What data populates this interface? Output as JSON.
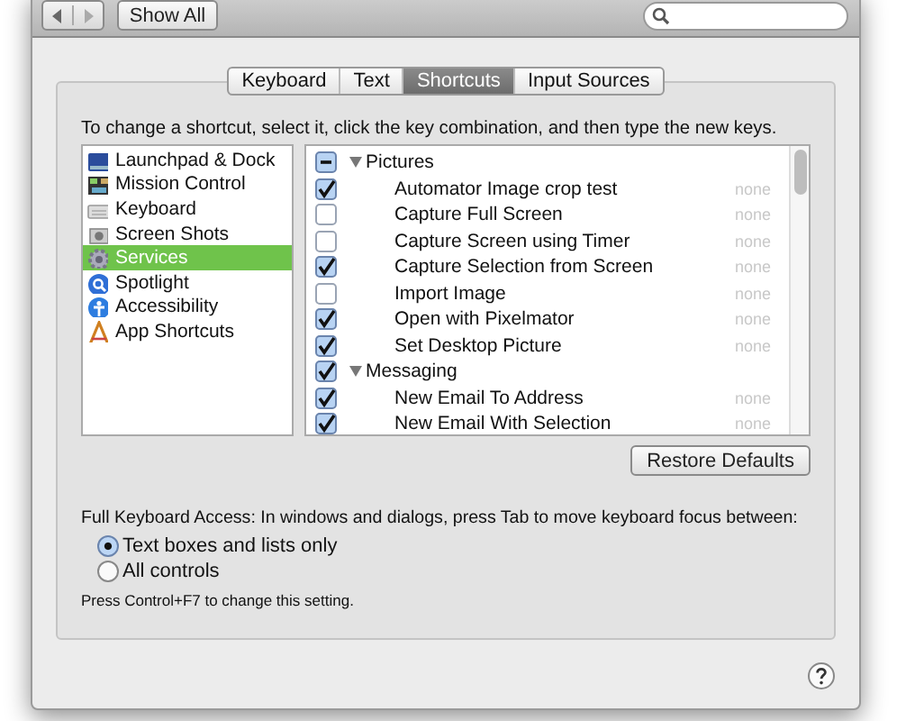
{
  "toolbar": {
    "show_all": "Show All"
  },
  "tabs": [
    {
      "label": "Keyboard",
      "selected": false
    },
    {
      "label": "Text",
      "selected": false
    },
    {
      "label": "Shortcuts",
      "selected": true
    },
    {
      "label": "Input Sources",
      "selected": false
    }
  ],
  "instruction": "To change a shortcut, select it, click the key combination, and then type the new keys.",
  "categories": [
    {
      "label": "Launchpad & Dock",
      "selected": false
    },
    {
      "label": "Mission Control",
      "selected": false
    },
    {
      "label": "Keyboard",
      "selected": false
    },
    {
      "label": "Screen Shots",
      "selected": false
    },
    {
      "label": "Services",
      "selected": true
    },
    {
      "label": "Spotlight",
      "selected": false
    },
    {
      "label": "Accessibility",
      "selected": false
    },
    {
      "label": "App Shortcuts",
      "selected": false
    }
  ],
  "services": [
    {
      "label": "Pictures",
      "mixed": true,
      "expanded": true,
      "children": [
        {
          "label": "Automator Image crop test",
          "checked": true,
          "shortcut": "none"
        },
        {
          "label": "Capture Full Screen",
          "checked": false,
          "shortcut": "none"
        },
        {
          "label": "Capture Screen using Timer",
          "checked": false,
          "shortcut": "none"
        },
        {
          "label": "Capture Selection from Screen",
          "checked": true,
          "shortcut": "none"
        },
        {
          "label": "Import Image",
          "checked": false,
          "shortcut": "none"
        },
        {
          "label": "Open with Pixelmator",
          "checked": true,
          "shortcut": "none"
        },
        {
          "label": "Set Desktop Picture",
          "checked": true,
          "shortcut": "none"
        }
      ]
    },
    {
      "label": "Messaging",
      "checked": true,
      "mixed": false,
      "expanded": true,
      "children": [
        {
          "label": "New Email To Address",
          "checked": true,
          "shortcut": "none"
        },
        {
          "label": "New Email With Selection",
          "checked": true,
          "shortcut": "none"
        }
      ]
    }
  ],
  "restore_button": "Restore Defaults",
  "keyboard_access": {
    "label": "Full Keyboard Access: In windows and dialogs, press Tab to move keyboard focus between:",
    "options": [
      {
        "label": "Text boxes and lists only",
        "selected": true
      },
      {
        "label": "All controls",
        "selected": false
      }
    ],
    "hint": "Press Control+F7 to change this setting."
  }
}
